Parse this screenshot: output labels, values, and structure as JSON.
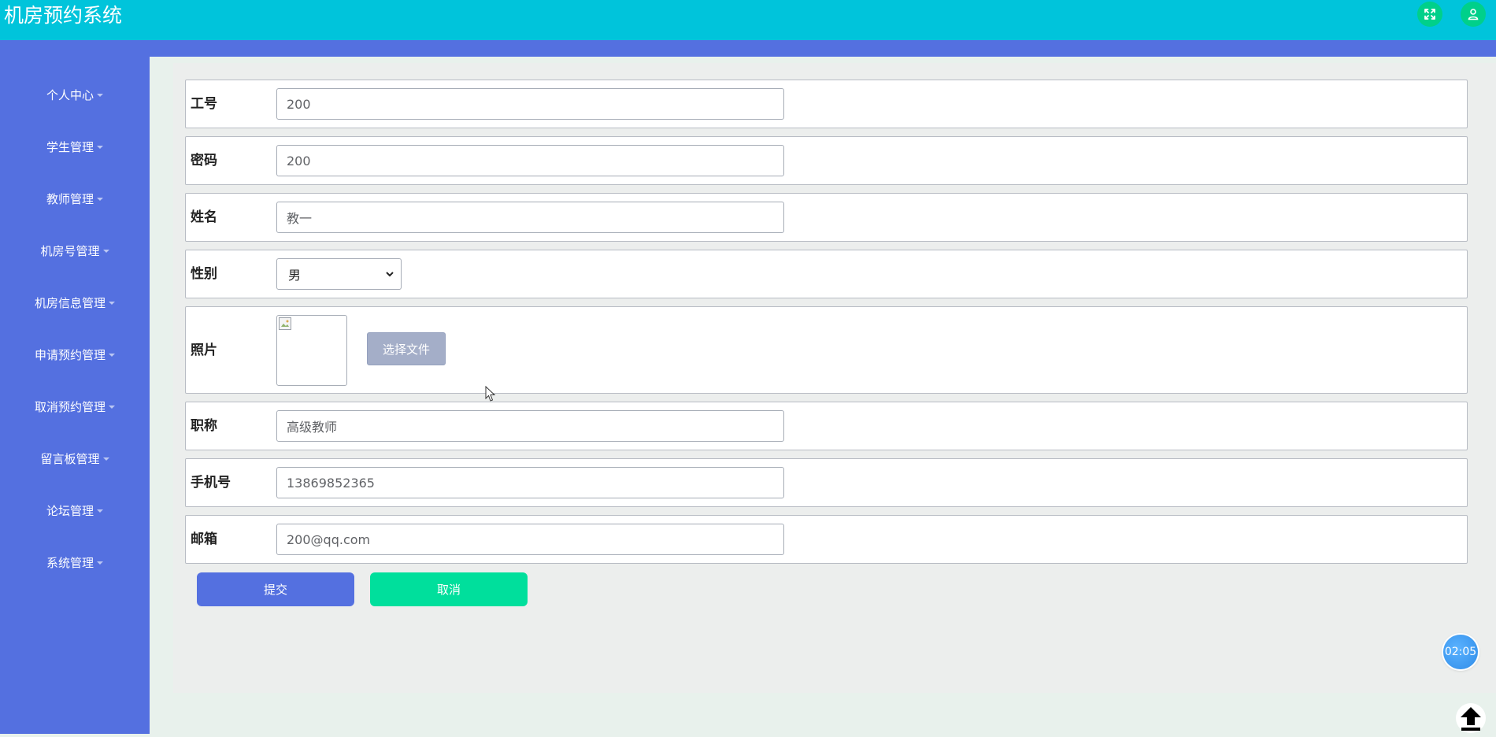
{
  "header": {
    "title": "机房预约系统",
    "fullscreen_icon": "expand-arrows-icon",
    "user_icon": "user-icon"
  },
  "sidebar": {
    "items": [
      {
        "label": "个人中心"
      },
      {
        "label": "学生管理"
      },
      {
        "label": "教师管理"
      },
      {
        "label": "机房号管理"
      },
      {
        "label": "机房信息管理"
      },
      {
        "label": "申请预约管理"
      },
      {
        "label": "取消预约管理"
      },
      {
        "label": "留言板管理"
      },
      {
        "label": "论坛管理"
      },
      {
        "label": "系统管理"
      }
    ]
  },
  "form": {
    "employee_id": {
      "label": "工号",
      "value": "200"
    },
    "password": {
      "label": "密码",
      "value": "200"
    },
    "name": {
      "label": "姓名",
      "value": "教一"
    },
    "gender": {
      "label": "性别",
      "value": "男"
    },
    "photo": {
      "label": "照片",
      "button_label": "选择文件"
    },
    "title": {
      "label": "职称",
      "value": "高级教师"
    },
    "phone": {
      "label": "手机号",
      "value": "13869852365"
    },
    "email": {
      "label": "邮箱",
      "value": "200@qq.com"
    }
  },
  "actions": {
    "submit_label": "提交",
    "cancel_label": "取消"
  },
  "widgets": {
    "timer": "02:05"
  },
  "colors": {
    "topbar": "#00c4db",
    "sidebar": "#5470e0",
    "submit": "#5470e0",
    "cancel": "#00df9c",
    "icon_button": "#00d08a"
  }
}
